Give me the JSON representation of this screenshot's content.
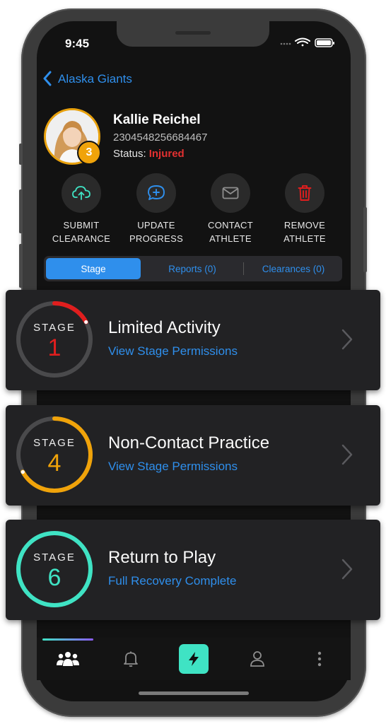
{
  "status_bar": {
    "time": "9:45"
  },
  "nav": {
    "back_label": "Alaska Giants"
  },
  "athlete": {
    "name": "Kallie Reichel",
    "id": "2304548256684467",
    "status_label": "Status:",
    "status_value": "Injured",
    "stage_badge": "3"
  },
  "actions": [
    {
      "line1": "SUBMIT",
      "line2": "CLEARANCE",
      "icon": "cloud-upload-icon"
    },
    {
      "line1": "UPDATE",
      "line2": "PROGRESS",
      "icon": "chat-plus-icon"
    },
    {
      "line1": "CONTACT",
      "line2": "ATHLETE",
      "icon": "mail-icon"
    },
    {
      "line1": "REMOVE",
      "line2": "ATHLETE",
      "icon": "trash-icon"
    }
  ],
  "tabs": [
    {
      "label": "Stage",
      "active": true
    },
    {
      "label": "Reports (0)",
      "active": false
    },
    {
      "label": "Clearances (0)",
      "active": false
    }
  ],
  "stages": [
    {
      "word": "STAGE",
      "number": "1",
      "title": "Limited Activity",
      "subtitle": "View Stage Permissions",
      "color": "#e01e1e",
      "progress": 0.17
    },
    {
      "word": "STAGE",
      "number": "4",
      "title": "Non-Contact Practice",
      "subtitle": "View Stage Permissions",
      "color": "#f0a30a",
      "progress": 0.67
    },
    {
      "word": "STAGE",
      "number": "6",
      "title": "Return to Play",
      "subtitle": "Full Recovery Complete",
      "color": "#3fe3c4",
      "progress": 1.0
    }
  ],
  "tabbar": {
    "items": [
      "team-icon",
      "bell-icon",
      "bolt-icon",
      "profile-icon",
      "more-icon"
    ],
    "active": "team-icon"
  },
  "colors": {
    "accent": "#2f8fec",
    "danger": "#e23030",
    "teal": "#3fe3c4",
    "orange": "#f0a30a"
  }
}
